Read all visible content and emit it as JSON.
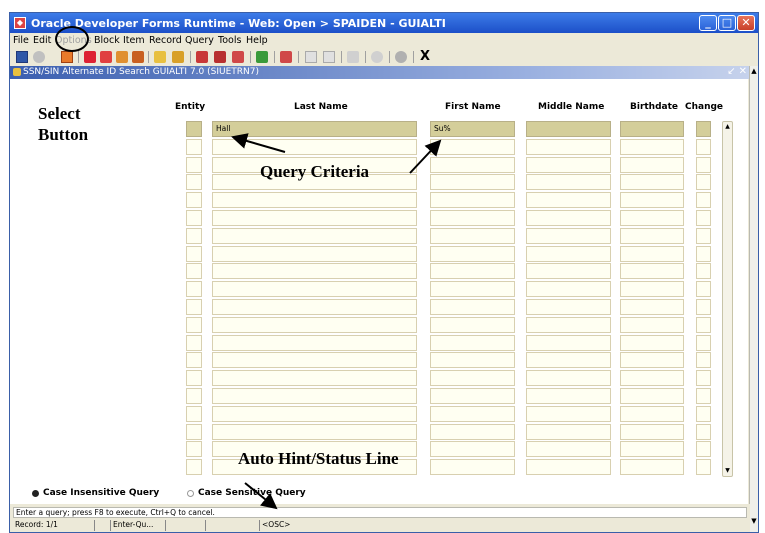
{
  "window": {
    "title": "Oracle Developer Forms Runtime - Web:  Open > SPAIDEN - GUIALTI",
    "controls": [
      "minimize",
      "maximize",
      "close"
    ]
  },
  "menubar": {
    "items": [
      {
        "label": "File",
        "enabled": true
      },
      {
        "label": "Edit",
        "enabled": true
      },
      {
        "label": "Options",
        "enabled": false
      },
      {
        "label": "Block",
        "enabled": true
      },
      {
        "label": "Item",
        "enabled": true
      },
      {
        "label": "Record",
        "enabled": true
      },
      {
        "label": "Query",
        "enabled": true
      },
      {
        "label": "Tools",
        "enabled": true
      },
      {
        "label": "Help",
        "enabled": true
      }
    ]
  },
  "toolbar": {
    "exit_label": "X",
    "icons": [
      "save-icon",
      "rollback-icon",
      "select-icon",
      "insert-record-icon",
      "remove-record-icon",
      "clear-record-icon",
      "next-block-icon",
      "previous-block-icon",
      "next-record-icon",
      "enter-query-icon",
      "execute-query-icon",
      "cancel-query-icon",
      "print-icon",
      "calendar-icon",
      "help-icon",
      "exit-icon"
    ]
  },
  "form": {
    "title": "SSN/SIN Alternate ID Search  GUIALTI  7.0  (SIUETRN7)",
    "columns": {
      "entity": "Entity",
      "last_name": "Last Name",
      "first_name": "First Name",
      "middle_name": "Middle Name",
      "birthdate": "Birthdate",
      "change": "Change"
    },
    "query_row": {
      "entity": "",
      "last_name": "Hall",
      "first_name": "Su%",
      "middle_name": "",
      "birthdate": "",
      "change": ""
    },
    "row_count": 20,
    "search_mode": {
      "insensitive_label": "Case Insensitive Query",
      "sensitive_label": "Case Sensitive Query",
      "selected": "insensitive"
    }
  },
  "annotations": {
    "select_button_line1": "Select",
    "select_button_line2": "Button",
    "query_criteria": "Query Criteria",
    "auto_hint": "Auto Hint/Status Line"
  },
  "status": {
    "hint": "Enter a query;  press F8 to execute, Ctrl+Q to cancel.",
    "record": "Record: 1/1",
    "field2": "",
    "mode": "Enter-Qu...",
    "field4": "",
    "field5": "",
    "osc": "<OSC>"
  }
}
